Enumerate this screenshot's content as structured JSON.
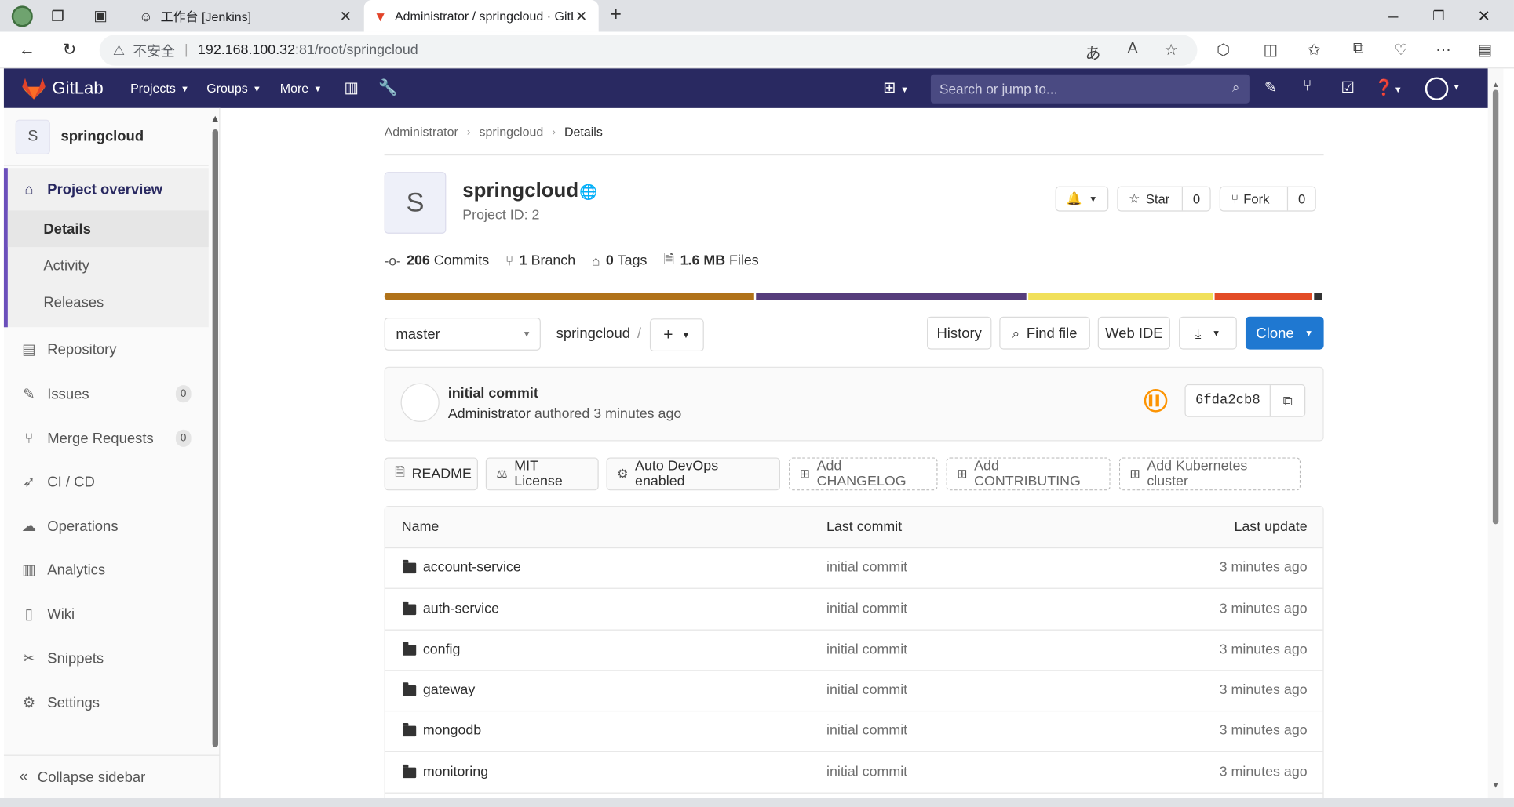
{
  "browser": {
    "tabs": [
      {
        "title": "工作台 [Jenkins]",
        "active": false
      },
      {
        "title": "Administrator / springcloud · GitLab",
        "active": true
      }
    ],
    "url": {
      "warning_label": "不安全",
      "host": "192.168.100.32",
      "rest": ":81/root/springcloud"
    }
  },
  "gitlab": {
    "brand": "GitLab",
    "nav": {
      "projects": "Projects",
      "groups": "Groups",
      "more": "More"
    },
    "search_placeholder": "Search or jump to..."
  },
  "sidebar": {
    "project_initial": "S",
    "project_name": "springcloud",
    "overview": "Project overview",
    "sub": [
      "Details",
      "Activity",
      "Releases"
    ],
    "items": [
      {
        "label": "Repository",
        "icon": "book-icon"
      },
      {
        "label": "Issues",
        "icon": "issues-icon",
        "count": "0"
      },
      {
        "label": "Merge Requests",
        "icon": "merge-request-icon",
        "count": "0"
      },
      {
        "label": "CI / CD",
        "icon": "rocket-icon"
      },
      {
        "label": "Operations",
        "icon": "cloud-gear-icon"
      },
      {
        "label": "Analytics",
        "icon": "chart-icon"
      },
      {
        "label": "Wiki",
        "icon": "book-icon"
      },
      {
        "label": "Snippets",
        "icon": "scissors-icon"
      },
      {
        "label": "Settings",
        "icon": "gear-icon"
      }
    ],
    "collapse": "Collapse sidebar"
  },
  "breadcrumb": [
    "Administrator",
    "springcloud",
    "Details"
  ],
  "project": {
    "initial": "S",
    "name": "springcloud",
    "id_text": "Project ID: 2",
    "star_label": "Star",
    "star_count": "0",
    "fork_label": "Fork",
    "fork_count": "0"
  },
  "stats": {
    "commits_num": "206",
    "commits_label": "Commits",
    "branch_num": "1",
    "branch_label": "Branch",
    "tags_num": "0",
    "tags_label": "Tags",
    "files_num": "1.6 MB",
    "files_label": "Files"
  },
  "languages": [
    {
      "color": "#b07219",
      "share": 39.6
    },
    {
      "color": "#563d7c",
      "share": 28.9
    },
    {
      "color": "#f1e05a",
      "share": 19.7
    },
    {
      "color": "#e34c26",
      "share": 10.5
    },
    {
      "color": "#333333",
      "share": 0.8
    }
  ],
  "toolbar": {
    "branch": "master",
    "path": "springcloud",
    "path_sep": "/",
    "history": "History",
    "find_file": "Find file",
    "web_ide": "Web IDE",
    "clone": "Clone"
  },
  "commit": {
    "message": "initial commit",
    "author": "Administrator",
    "authored_text": "authored 3 minutes ago",
    "sha": "6fda2cb8"
  },
  "quick_links": [
    {
      "label": "README",
      "style": "solid"
    },
    {
      "label": "MIT License",
      "style": "solid"
    },
    {
      "label": "Auto DevOps enabled",
      "style": "solid"
    },
    {
      "label": "Add CHANGELOG",
      "style": "dashed"
    },
    {
      "label": "Add CONTRIBUTING",
      "style": "dashed"
    },
    {
      "label": "Add Kubernetes cluster",
      "style": "dashed"
    }
  ],
  "files": {
    "headers": [
      "Name",
      "Last commit",
      "Last update"
    ],
    "rows": [
      {
        "name": "account-service",
        "commit": "initial commit",
        "updated": "3 minutes ago"
      },
      {
        "name": "auth-service",
        "commit": "initial commit",
        "updated": "3 minutes ago"
      },
      {
        "name": "config",
        "commit": "initial commit",
        "updated": "3 minutes ago"
      },
      {
        "name": "gateway",
        "commit": "initial commit",
        "updated": "3 minutes ago"
      },
      {
        "name": "mongodb",
        "commit": "initial commit",
        "updated": "3 minutes ago"
      },
      {
        "name": "monitoring",
        "commit": "initial commit",
        "updated": "3 minutes ago"
      }
    ]
  }
}
